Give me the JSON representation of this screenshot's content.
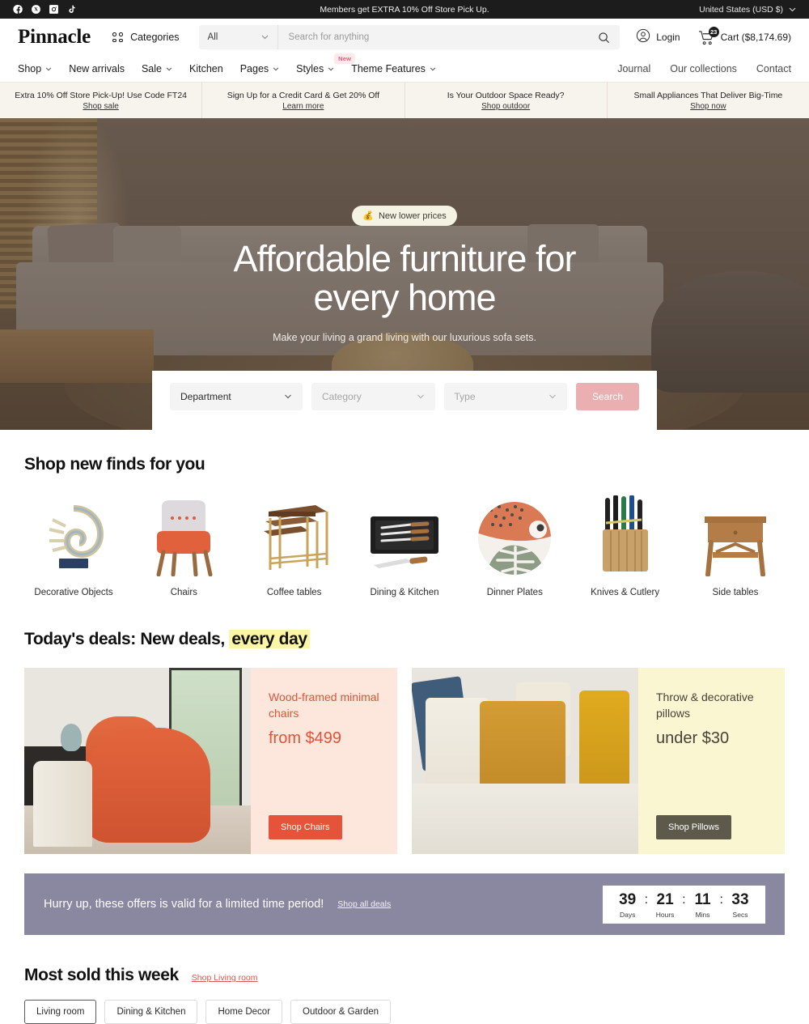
{
  "topbar": {
    "social": [
      {
        "name": "facebook-icon",
        "label": "Facebook"
      },
      {
        "name": "x-twitter-icon",
        "label": "X"
      },
      {
        "name": "instagram-icon",
        "label": "Instagram"
      },
      {
        "name": "tiktok-icon",
        "label": "TikTok"
      }
    ],
    "message": "Members get EXTRA 10% Off Store Pick Up.",
    "country": "United States (USD $)"
  },
  "header": {
    "logo": "Pinnacle",
    "categories_label": "Categories",
    "search": {
      "scope": "All",
      "placeholder": "Search for anything",
      "value": ""
    },
    "login_label": "Login",
    "cart_label": "Cart ($8,174.69)",
    "cart_count": "23"
  },
  "nav": {
    "left": [
      {
        "label": "Shop",
        "caret": true,
        "badge": ""
      },
      {
        "label": "New arrivals",
        "caret": false,
        "badge": ""
      },
      {
        "label": "Sale",
        "caret": true,
        "badge": ""
      },
      {
        "label": "Kitchen",
        "caret": false,
        "badge": ""
      },
      {
        "label": "Pages",
        "caret": true,
        "badge": ""
      },
      {
        "label": "Styles",
        "caret": true,
        "badge": "New"
      },
      {
        "label": "Theme Features",
        "caret": true,
        "badge": ""
      }
    ],
    "right": [
      {
        "label": "Journal"
      },
      {
        "label": "Our collections"
      },
      {
        "label": "Contact"
      }
    ]
  },
  "promos": [
    {
      "title": "Extra 10% Off Store Pick-Up! Use Code FT24",
      "link": "Shop sale"
    },
    {
      "title": "Sign Up for a Credit Card & Get 20% Off",
      "link": "Learn more"
    },
    {
      "title": "Is Your Outdoor Space Ready?",
      "link": "Shop outdoor"
    },
    {
      "title": "Small Appliances That Deliver Big-Time",
      "link": "Shop now"
    }
  ],
  "hero": {
    "pill_icon": "💰",
    "pill": "New lower prices",
    "heading_line1": "Affordable furniture for",
    "heading_line2": "every home",
    "subheading": "Make your living a grand living with our luxurious sofa sets.",
    "search": {
      "department": "Department",
      "category": "Category",
      "type": "Type",
      "button": "Search"
    }
  },
  "categories_section": {
    "title": "Shop new finds for you",
    "items": [
      {
        "label": "Decorative Objects",
        "icon": "ammonite-fossil-decor"
      },
      {
        "label": "Chairs",
        "icon": "orange-accent-chair"
      },
      {
        "label": "Coffee tables",
        "icon": "nesting-coffee-tables"
      },
      {
        "label": "Dining & Kitchen",
        "icon": "knife-gift-case"
      },
      {
        "label": "Dinner Plates",
        "icon": "patterned-dinner-plate"
      },
      {
        "label": "Knives & Cutlery",
        "icon": "knife-block-set"
      },
      {
        "label": "Side tables",
        "icon": "wooden-side-table"
      }
    ]
  },
  "deals_section": {
    "title_plain": "Today's deals: New deals, ",
    "title_highlight": "every day",
    "cards": [
      {
        "name": "wood-framed-chairs-deal",
        "line1": "Wood-framed minimal chairs",
        "line2": "from $499",
        "button": "Shop Chairs",
        "image": "orange-accent-chair-in-room"
      },
      {
        "name": "throw-pillows-deal",
        "line1": "Throw & decorative pillows",
        "line2": "under $30",
        "button": "Shop Pillows",
        "image": "gold-and-cream-pillows"
      }
    ]
  },
  "countdown": {
    "text": "Hurry up, these offers is valid for a limited time period!",
    "link": "Shop all deals",
    "units": [
      {
        "value": "39",
        "label": "Days"
      },
      {
        "value": "21",
        "label": "Hours"
      },
      {
        "value": "11",
        "label": "Mins"
      },
      {
        "value": "33",
        "label": "Secs"
      }
    ],
    "separator": ":"
  },
  "most_sold": {
    "title": "Most sold this week",
    "link": "Shop Living room",
    "tabs": [
      {
        "label": "Living room",
        "active": true
      },
      {
        "label": "Dining & Kitchen",
        "active": false
      },
      {
        "label": "Home Decor",
        "active": false
      },
      {
        "label": "Outdoor & Garden",
        "active": false
      }
    ]
  },
  "colors": {
    "accent_red": "#e5533a",
    "accent_pink": "#eaafb1",
    "highlight_yellow": "#fbf5a5",
    "countdown_bg": "#8a87a0",
    "promo_bg": "#f7f3ed"
  }
}
